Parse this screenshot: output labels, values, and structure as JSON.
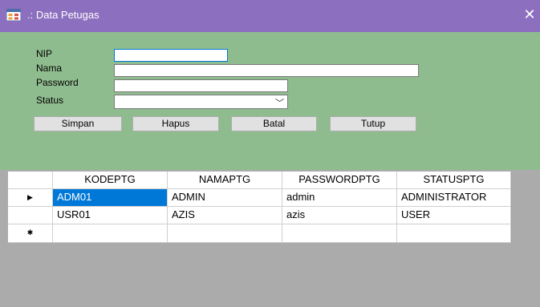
{
  "window": {
    "title": ".: Data Petugas",
    "close_glyph": "✕",
    "icon": "form-app-icon"
  },
  "form": {
    "labels": {
      "nip": "NIP",
      "nama": "Nama",
      "password": "Password",
      "status": "Status"
    },
    "fields": {
      "nip": "",
      "nama": "",
      "password": "",
      "status": ""
    },
    "buttons": {
      "simpan": "Simpan",
      "hapus": "Hapus",
      "batal": "Batal",
      "tutup": "Tutup"
    }
  },
  "grid": {
    "columns": [
      "KODEPTG",
      "NAMAPTG",
      "PASSWORDPTG",
      "STATUSPTG"
    ],
    "rows": [
      [
        "ADM01",
        "ADMIN",
        "admin",
        "ADMINISTRATOR"
      ],
      [
        "USR01",
        "AZIS",
        "azis",
        "USER"
      ]
    ],
    "row_markers": {
      "current": "▶",
      "new": "✱"
    }
  },
  "colors": {
    "titlebar": "#8c6fbf",
    "form_bg": "#8fbc8f",
    "selection": "#0078d7",
    "empty_area": "#ababab"
  }
}
